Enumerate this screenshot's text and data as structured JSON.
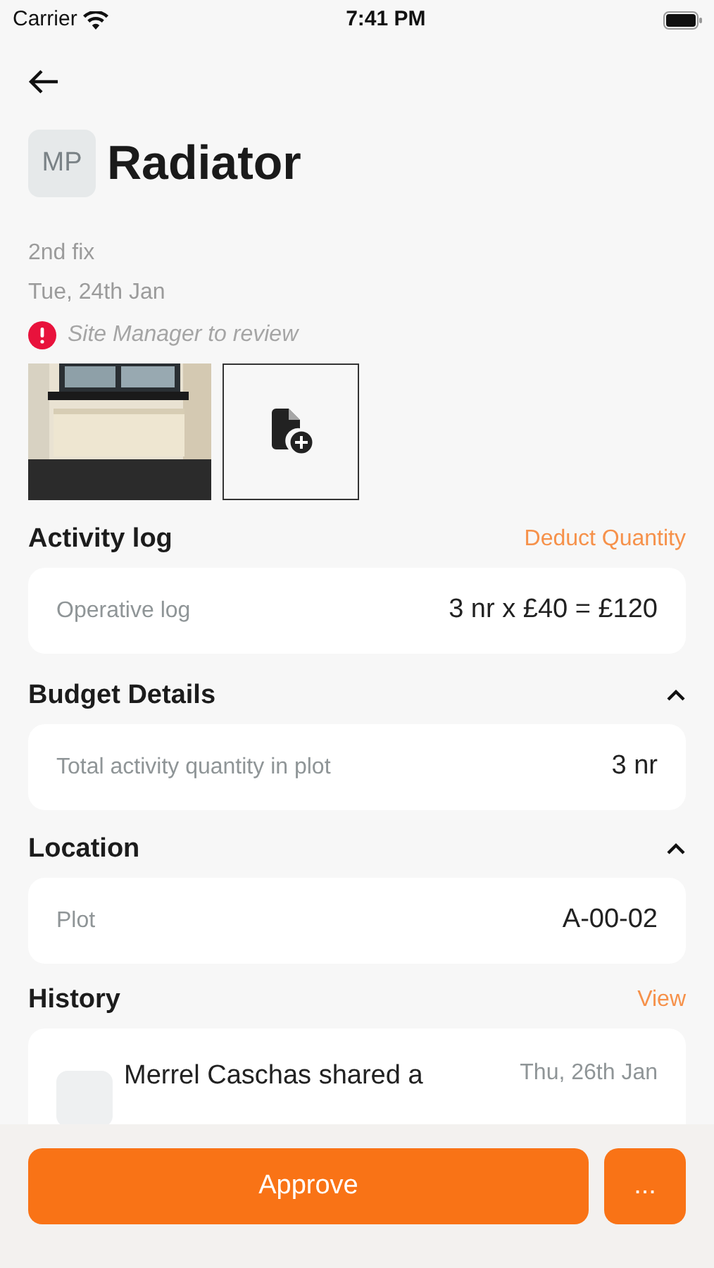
{
  "status_bar": {
    "carrier": "Carrier",
    "time": "7:41 PM"
  },
  "header": {
    "avatar": "MP",
    "title": "Radiator",
    "subtitle": "2nd fix",
    "date": "Tue, 24th Jan",
    "status": "Site Manager to review"
  },
  "photos": [
    {
      "kind": "picture"
    },
    {
      "kind": "add"
    }
  ],
  "sections": [
    {
      "title": "Activity log",
      "action": "Deduct Quantity",
      "rows": [
        {
          "label": "Operative log",
          "value": "3 nr x £40 = £120"
        }
      ]
    },
    {
      "title": "Budget Details",
      "expanded": true,
      "rows": [
        {
          "label": "Total activity quantity in plot",
          "value": "3 nr"
        }
      ]
    },
    {
      "title": "Location",
      "expanded": true,
      "rows": [
        {
          "label": "Plot",
          "value": "A-00-02"
        }
      ]
    }
  ],
  "history": {
    "title": "History",
    "action": "View",
    "entries": [
      {
        "text": "Merrel Caschas shared a",
        "date": "Thu, 26th Jan"
      }
    ]
  },
  "footer": {
    "primary": "Approve",
    "more": "..."
  }
}
